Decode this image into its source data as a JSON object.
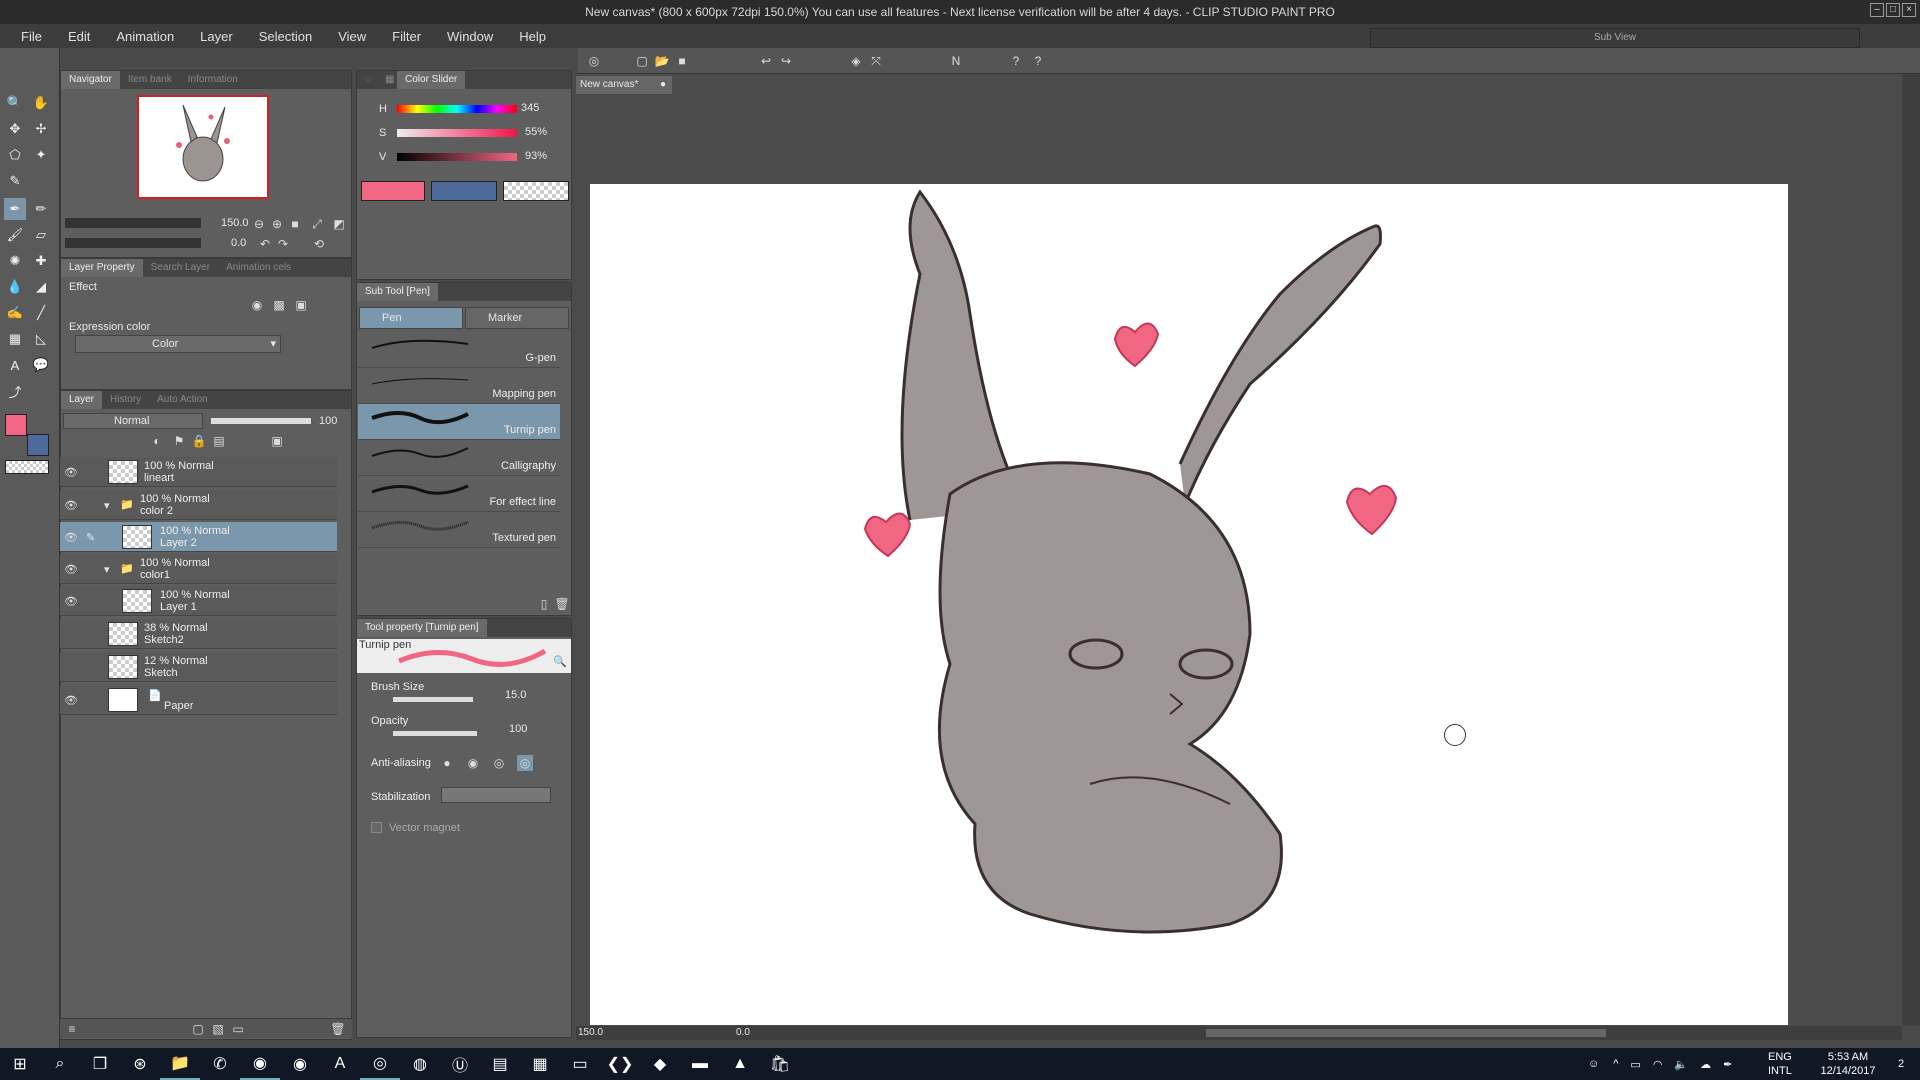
{
  "window": {
    "title": "New canvas* (800 x 600px 72dpi 150.0%)  You can use all features - Next license verification will be after 4 days. - CLIP STUDIO PAINT PRO",
    "subview_title": "Sub View"
  },
  "menu": [
    "File",
    "Edit",
    "Animation",
    "Layer",
    "Selection",
    "View",
    "Filter",
    "Window",
    "Help"
  ],
  "navigator": {
    "tabs": [
      "Navigator",
      "Item bank",
      "Information"
    ],
    "zoom": "150.0",
    "rotation": "0.0"
  },
  "layer_property": {
    "tabs": [
      "Layer Property",
      "Search Layer",
      "Animation cels"
    ],
    "effect_label": "Effect",
    "expression_color_label": "Expression color",
    "expression_color_value": "Color"
  },
  "layer_panel": {
    "tabs": [
      "Layer",
      "History",
      "Auto Action"
    ],
    "blend_mode": "Normal",
    "opacity": "100",
    "layers": [
      {
        "l1": "100 % Normal",
        "l2": "lineart"
      },
      {
        "l1": "100 % Normal",
        "l2": "color 2"
      },
      {
        "l1": "100 % Normal",
        "l2": "Layer 2"
      },
      {
        "l1": "100 % Normal",
        "l2": "color1"
      },
      {
        "l1": "100 % Normal",
        "l2": "Layer 1"
      },
      {
        "l1": "38 % Normal",
        "l2": "Sketch2"
      },
      {
        "l1": "12 % Normal",
        "l2": "Sketch"
      },
      {
        "l1": "",
        "l2": "Paper"
      }
    ]
  },
  "color_slider": {
    "tab": "Color Slider",
    "h_label": "H",
    "s_label": "S",
    "v_label": "V",
    "h": "345",
    "s": "55%",
    "v": "93%",
    "h_level": 0.96,
    "s_level": 0.55,
    "v_level": 0.93,
    "main_color": "#f06683",
    "sub_color": "#4e6a9a"
  },
  "sub_tool": {
    "tab": "Sub Tool [Pen]",
    "groups": [
      "Pen",
      "Marker"
    ],
    "brushes": [
      "G-pen",
      "Mapping pen",
      "Turnip pen",
      "Calligraphy",
      "For effect line",
      "Textured pen"
    ]
  },
  "tool_property": {
    "tab": "Tool property [Turnip pen]",
    "tool_name": "Turnip pen",
    "brush_size_label": "Brush Size",
    "brush_size": "15.0",
    "opacity_label": "Opacity",
    "opacity": "100",
    "antialias_label": "Anti-aliasing",
    "stabilization_label": "Stabilization",
    "vector_magnet_label": "Vector magnet"
  },
  "canvas": {
    "tab": "New canvas*",
    "status_zoom": "150.0",
    "status_rotation": "0.0"
  },
  "taskbar": {
    "lang1": "ENG",
    "lang2": "INTL",
    "time": "5:53 AM",
    "date": "12/14/2017",
    "notif_count": "2"
  },
  "icons": [
    "windows-icon",
    "search-icon",
    "task-view-icon",
    "file-explorer-icon",
    "whatsapp-icon",
    "chrome-icon",
    "clip-studio-icon",
    "photos-icon",
    "store-icon"
  ]
}
